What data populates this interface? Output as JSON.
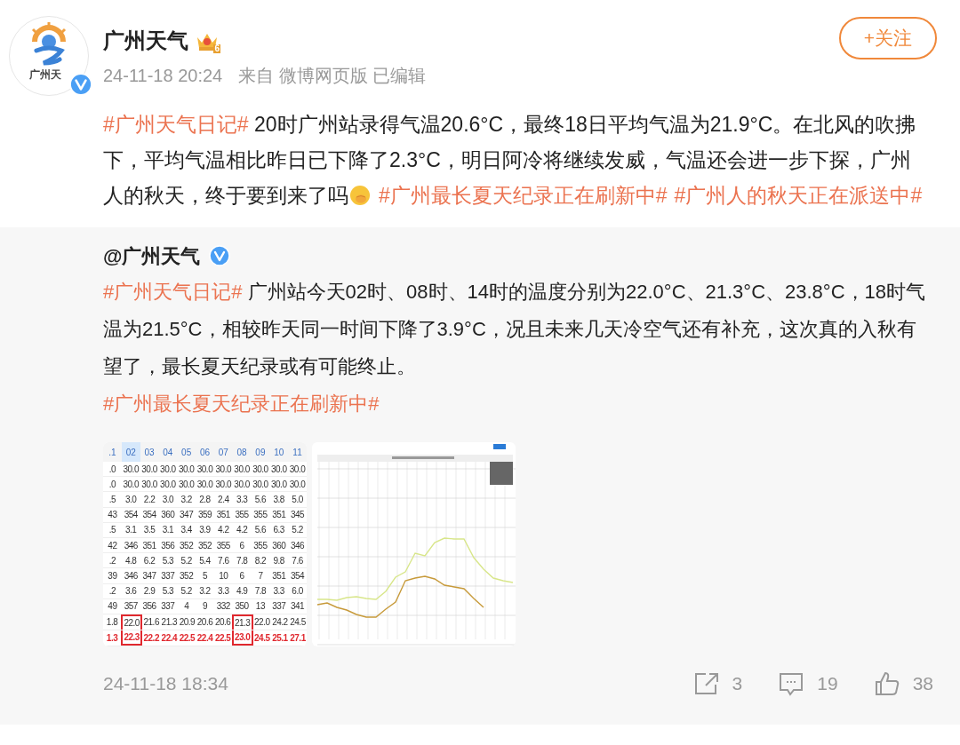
{
  "post": {
    "author": {
      "name": "广州天气",
      "badge_level": "6",
      "verified": true,
      "avatar_caption": "广州天"
    },
    "follow_button": "+关注",
    "meta": {
      "time": "24-11-18 20:24",
      "source": "来自 微博网页版",
      "edited": "已编辑"
    },
    "paragraphs": [
      [
        {
          "kind": "hashtag",
          "text": "#广州天气日记#"
        },
        {
          "kind": "text",
          "text": " 20时广州站录得气温20.6°C，最终18日平均气温为21.9°C。在北风的吹拂下，平均气温相比昨日已下降了2.3°C，明日阿冷将继续发威，气温还会进一步下探，广州人的秋天，终于要到来了吗"
        },
        {
          "kind": "emoji"
        },
        {
          "kind": "hashtag",
          "text": "#广州最长夏天纪录正在刷新中#"
        },
        {
          "kind": "hashtag",
          "text": "#广州人的秋天正在派送中#"
        }
      ]
    ]
  },
  "repost": {
    "author": {
      "name": "@广州天气",
      "verified": true
    },
    "paragraphs": [
      [
        {
          "kind": "hashtag",
          "text": "#广州天气日记#"
        },
        {
          "kind": "text",
          "text": " 广州站今天02时、08时、14时的温度分别为22.0°C、21.3°C、23.8°C，18时气温为21.5°C，相较昨天同一时间下降了3.9°C，况且未来几天冷空气还有补充，这次真的入秋有望了，最长夏天纪录或有可能终止。"
        }
      ],
      [
        {
          "kind": "hashtag",
          "text": "#广州最长夏天纪录正在刷新中#"
        }
      ]
    ],
    "images": [
      {
        "kind": "table",
        "columns": [
          {
            "label": ".1",
            "selected": false,
            "boxed": false
          },
          {
            "label": "02",
            "selected": true,
            "boxed": true
          },
          {
            "label": "03",
            "selected": false,
            "boxed": false
          },
          {
            "label": "04",
            "selected": false,
            "boxed": false
          },
          {
            "label": "05",
            "selected": false,
            "boxed": false
          },
          {
            "label": "06",
            "selected": false,
            "boxed": false
          },
          {
            "label": "07",
            "selected": false,
            "boxed": false
          },
          {
            "label": "08",
            "selected": false,
            "boxed": true
          },
          {
            "label": "09",
            "selected": false,
            "boxed": false
          },
          {
            "label": "10",
            "selected": false,
            "boxed": false
          },
          {
            "label": "11",
            "selected": false,
            "boxed": false
          }
        ],
        "rows": [
          {
            "red": false,
            "cells": [
              ".0",
              "30.0",
              "30.0",
              "30.0",
              "30.0",
              "30.0",
              "30.0",
              "30.0",
              "30.0",
              "30.0",
              "30.0"
            ]
          },
          {
            "red": false,
            "cells": [
              ".0",
              "30.0",
              "30.0",
              "30.0",
              "30.0",
              "30.0",
              "30.0",
              "30.0",
              "30.0",
              "30.0",
              "30.0"
            ]
          },
          {
            "red": false,
            "cells": [
              ".5",
              "3.0",
              "2.2",
              "3.0",
              "3.2",
              "2.8",
              "2.4",
              "3.3",
              "5.6",
              "3.8",
              "5.0"
            ]
          },
          {
            "red": false,
            "cells": [
              "43",
              "354",
              "354",
              "360",
              "347",
              "359",
              "351",
              "355",
              "355",
              "351",
              "345"
            ]
          },
          {
            "red": false,
            "cells": [
              ".5",
              "3.1",
              "3.5",
              "3.1",
              "3.4",
              "3.9",
              "4.2",
              "4.2",
              "5.6",
              "6.3",
              "5.2"
            ]
          },
          {
            "red": false,
            "cells": [
              "42",
              "346",
              "351",
              "356",
              "352",
              "352",
              "355",
              "6",
              "355",
              "360",
              "346"
            ]
          },
          {
            "red": false,
            "cells": [
              ".2",
              "4.8",
              "6.2",
              "5.3",
              "5.2",
              "5.4",
              "7.6",
              "7.8",
              "8.2",
              "9.8",
              "7.6"
            ]
          },
          {
            "red": false,
            "cells": [
              "39",
              "346",
              "347",
              "337",
              "352",
              "5",
              "10",
              "6",
              "7",
              "351",
              "354"
            ]
          },
          {
            "red": false,
            "cells": [
              ".2",
              "3.6",
              "2.9",
              "5.3",
              "5.2",
              "3.2",
              "3.3",
              "4.9",
              "7.8",
              "3.3",
              "6.0"
            ]
          },
          {
            "red": false,
            "cells": [
              "49",
              "357",
              "356",
              "337",
              "4",
              "9",
              "332",
              "350",
              "13",
              "337",
              "341"
            ]
          },
          {
            "red": false,
            "cells": [
              "1.8",
              "22.0",
              "21.6",
              "21.3",
              "20.9",
              "20.6",
              "20.6",
              "21.3",
              "22.0",
              "24.2",
              "24.5"
            ]
          },
          {
            "red": true,
            "cells": [
              "1.3",
              "22.3",
              "22.2",
              "22.4",
              "22.5",
              "22.4",
              "22.5",
              "23.0",
              "24.5",
              "25.1",
              "27.1"
            ]
          }
        ]
      },
      {
        "kind": "chart"
      }
    ],
    "time": "24-11-18 18:34",
    "stats": [
      {
        "kind": "repost",
        "count": "3"
      },
      {
        "kind": "comment",
        "count": "19"
      },
      {
        "kind": "like",
        "count": "38"
      }
    ]
  }
}
